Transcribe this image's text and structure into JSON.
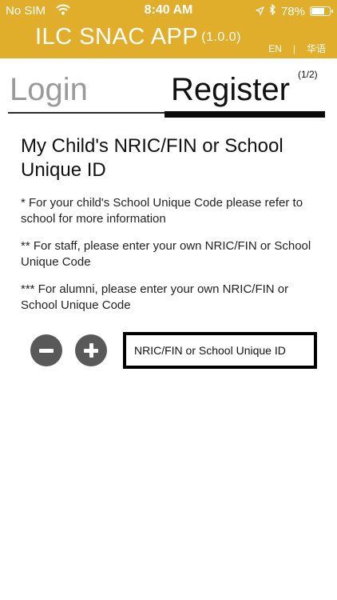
{
  "status_bar": {
    "carrier": "No SIM",
    "time": "8:40 AM",
    "battery_percent": "78%",
    "battery_level": 0.78,
    "icons": [
      "wifi-icon",
      "location-arrow-icon",
      "bluetooth-icon",
      "battery-icon"
    ]
  },
  "header": {
    "app_name": "ILC SNAC APP",
    "version": "(1.0.0)",
    "lang_en": "EN",
    "lang_separator": "|",
    "lang_zh": "华语",
    "bg_color": "#E1AE2B"
  },
  "tabs": {
    "login": "Login",
    "register": "Register",
    "step": "(1/2)"
  },
  "form": {
    "heading": "My Child's NRIC/FIN or School Unique ID",
    "notes": [
      "* For your child's School Unique Code please refer to school for more information",
      "** For staff, please enter your own NRIC/FIN or School Unique Code",
      "*** For alumni, please enter your own NRIC/FIN or School Unique Code"
    ],
    "id_placeholder": "NRIC/FIN or School Unique ID",
    "minus_icon": "minus-circle-icon",
    "plus_icon": "plus-circle-icon"
  }
}
